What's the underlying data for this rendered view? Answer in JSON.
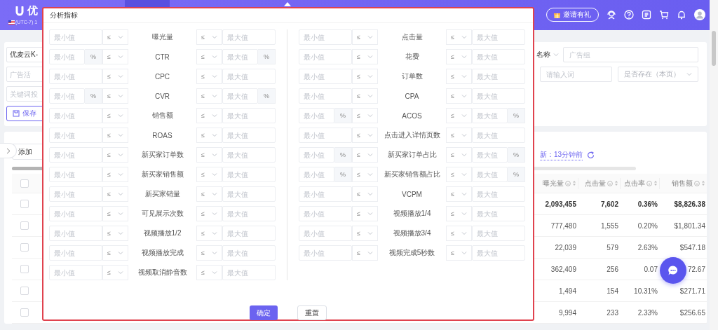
{
  "header": {
    "logo_text": "优",
    "timezone": "(UTC-7) 1",
    "invite_button": "邀请有礼"
  },
  "filters": {
    "account_select": "优麦云K-",
    "campaign_placeholder": "广告活",
    "keyword_placeholder": "关键词投",
    "save_button": "保存",
    "name_select": "名称",
    "ad_group_placeholder": "广告组",
    "word_placeholder": "请输入词",
    "exists_select": "是否存在（本页）"
  },
  "toolbar": {
    "add_button": "添加",
    "updated": "新：13分钟前"
  },
  "table": {
    "select_all_checked": false,
    "columns": [
      "曝光量",
      "点击量",
      "点击率",
      "销售额"
    ],
    "rows": [
      {
        "checked": false,
        "bold": true,
        "cells": [
          "2,093,455",
          "7,602",
          "0.36%",
          "$8,826.38"
        ]
      },
      {
        "checked": false,
        "bold": false,
        "cells": [
          "777,480",
          "1,555",
          "0.20%",
          "$1,801.34"
        ]
      },
      {
        "checked": false,
        "bold": false,
        "cells": [
          "22,039",
          "579",
          "2.63%",
          "$547.18"
        ]
      },
      {
        "checked": false,
        "bold": false,
        "cells": [
          "362,409",
          "256",
          "0.07",
          "72.67"
        ]
      },
      {
        "checked": false,
        "bold": false,
        "cells": [
          "1,494",
          "154",
          "10.31%",
          "$271.71"
        ]
      },
      {
        "checked": false,
        "bold": false,
        "cells": [
          "9,994",
          "233",
          "2.33%",
          "$256.65"
        ]
      }
    ]
  },
  "dialog": {
    "title": "分析指标",
    "confirm_button": "确定",
    "reset_button": "重置",
    "columns": [
      {
        "rows": [
          {
            "label": "曝光量",
            "min_placeholder": "最小值",
            "min_operator": "≤",
            "max_operator": "≤",
            "max_placeholder": "最大值"
          },
          {
            "label": "CTR",
            "min_placeholder": "最小值",
            "min_unit": "%",
            "min_operator": "≤",
            "max_operator": "≤",
            "max_placeholder": "最大值",
            "max_unit": "%"
          },
          {
            "label": "CPC",
            "min_placeholder": "最小值",
            "min_operator": "≤",
            "max_operator": "≤",
            "max_placeholder": "最大值"
          },
          {
            "label": "CVR",
            "min_placeholder": "最小值",
            "min_unit": "%",
            "min_operator": "≤",
            "max_operator": "≤",
            "max_placeholder": "最大值",
            "max_unit": "%"
          },
          {
            "label": "销售额",
            "min_placeholder": "最小值",
            "min_operator": "≤",
            "max_operator": "≤",
            "max_placeholder": "最大值"
          },
          {
            "label": "ROAS",
            "min_placeholder": "最小值",
            "min_operator": "≤",
            "max_operator": "≤",
            "max_placeholder": "最大值"
          },
          {
            "label": "新买家订单数",
            "min_placeholder": "最小值",
            "min_operator": "≤",
            "max_operator": "≤",
            "max_placeholder": "最大值"
          },
          {
            "label": "新买家销售额",
            "min_placeholder": "最小值",
            "min_operator": "≤",
            "max_operator": "≤",
            "max_placeholder": "最大值"
          },
          {
            "label": "新买家销量",
            "min_placeholder": "最小值",
            "min_operator": "≤",
            "max_operator": "≤",
            "max_placeholder": "最大值"
          },
          {
            "label": "可见展示次数",
            "min_placeholder": "最小值",
            "min_operator": "≤",
            "max_operator": "≤",
            "max_placeholder": "最大值"
          },
          {
            "label": "视频播放1/2",
            "min_placeholder": "最小值",
            "min_operator": "≤",
            "max_operator": "≤",
            "max_placeholder": "最大值"
          },
          {
            "label": "视频播放完成",
            "min_placeholder": "最小值",
            "min_operator": "≤",
            "max_operator": "≤",
            "max_placeholder": "最大值"
          },
          {
            "label": "视频取消静音数",
            "min_placeholder": "最小值",
            "min_operator": "≤",
            "max_operator": "≤",
            "max_placeholder": "最大值"
          }
        ]
      },
      {
        "rows": [
          {
            "label": "点击量",
            "min_placeholder": "最小值",
            "min_operator": "≤",
            "max_operator": "≤",
            "max_placeholder": "最大值"
          },
          {
            "label": "花费",
            "min_placeholder": "最小值",
            "min_operator": "≤",
            "max_operator": "≤",
            "max_placeholder": "最大值"
          },
          {
            "label": "订单数",
            "min_placeholder": "最小值",
            "min_operator": "≤",
            "max_operator": "≤",
            "max_placeholder": "最大值"
          },
          {
            "label": "CPA",
            "min_placeholder": "最小值",
            "min_operator": "≤",
            "max_operator": "≤",
            "max_placeholder": "最大值"
          },
          {
            "label": "ACOS",
            "min_placeholder": "最小值",
            "min_unit": "%",
            "min_operator": "≤",
            "max_operator": "≤",
            "max_placeholder": "最大值",
            "max_unit": "%"
          },
          {
            "label": "点击进入详情页数",
            "min_placeholder": "最小值",
            "min_operator": "≤",
            "max_operator": "≤",
            "max_placeholder": "最大值"
          },
          {
            "label": "新买家订单占比",
            "min_placeholder": "最小值",
            "min_unit": "%",
            "min_operator": "≤",
            "max_operator": "≤",
            "max_placeholder": "最大值",
            "max_unit": "%"
          },
          {
            "label": "新买家销售额占比",
            "min_placeholder": "最小值",
            "min_unit": "%",
            "min_operator": "≤",
            "max_operator": "≤",
            "max_placeholder": "最大值",
            "max_unit": "%"
          },
          {
            "label": "VCPM",
            "min_placeholder": "最小值",
            "min_operator": "≤",
            "max_operator": "≤",
            "max_placeholder": "最大值"
          },
          {
            "label": "视频播放1/4",
            "min_placeholder": "最小值",
            "min_operator": "≤",
            "max_operator": "≤",
            "max_placeholder": "最大值"
          },
          {
            "label": "视频播放3/4",
            "min_placeholder": "最小值",
            "min_operator": "≤",
            "max_operator": "≤",
            "max_placeholder": "最大值"
          },
          {
            "label": "视频完成5秒数",
            "min_placeholder": "最小值",
            "min_operator": "≤",
            "max_operator": "≤",
            "max_placeholder": "最大值"
          }
        ]
      }
    ]
  }
}
